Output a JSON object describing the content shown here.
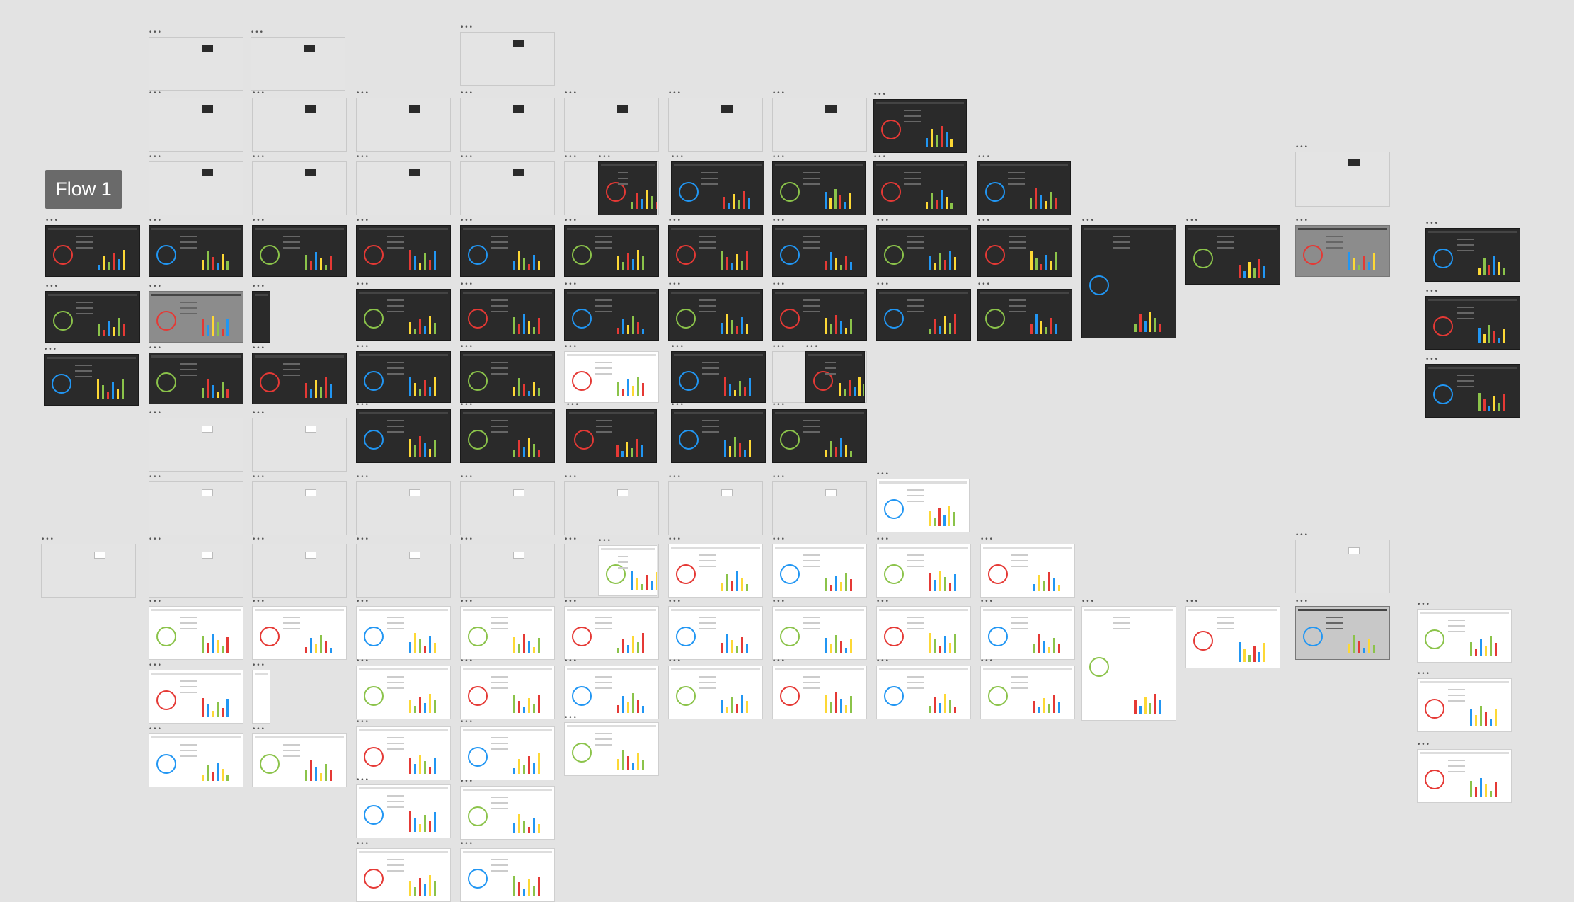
{
  "canvas": {
    "flow_label": "Flow 1"
  },
  "artboard_menu_glyph": "•••",
  "theme": {
    "canvas_bg": "#e3e3e3",
    "dark_board": "#2a2a2a",
    "light_board": "#ffffff",
    "accent_green": "#8bc34a",
    "accent_red": "#e53935",
    "accent_blue": "#2196f3",
    "accent_yellow": "#fdd835"
  },
  "icons": [
    "more-horizontal-icon"
  ]
}
